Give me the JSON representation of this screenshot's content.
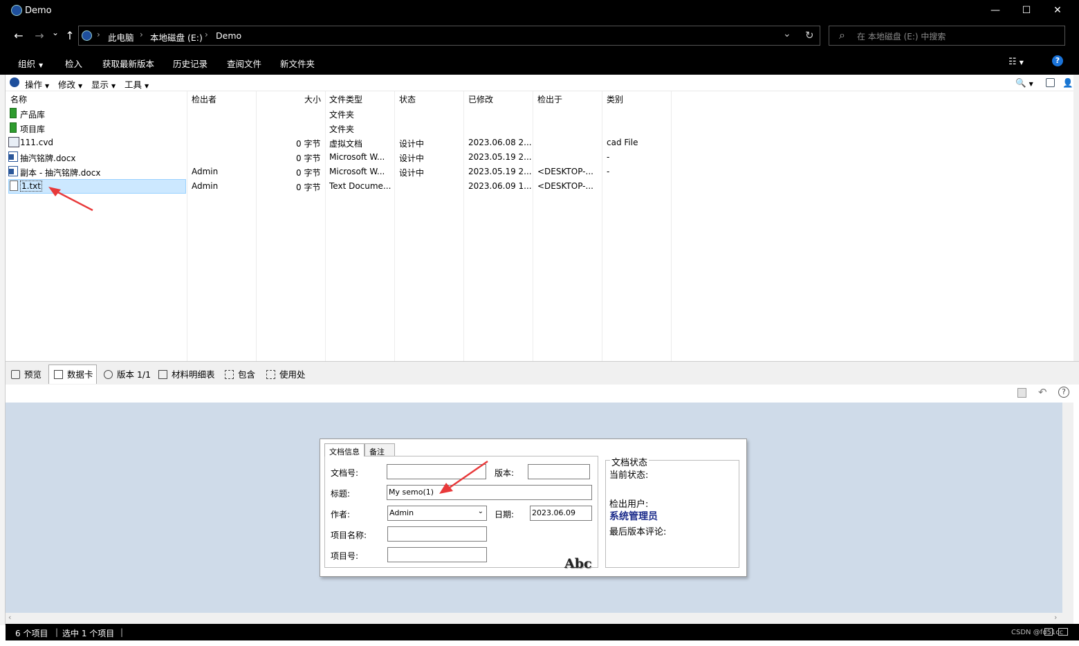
{
  "window": {
    "title": "Demo",
    "min": "—",
    "max": "☐",
    "close": "✕"
  },
  "nav": {
    "back": "←",
    "forward": "→",
    "down": "⌄",
    "up": "↑"
  },
  "address": {
    "crumbs": [
      "此电脑",
      "本地磁盘 (E:)",
      "Demo"
    ],
    "refresh": "↻",
    "dropdown": "⌄"
  },
  "search": {
    "placeholder": "在 本地磁盘 (E:) 中搜索",
    "icon": "⌕"
  },
  "commands": [
    "组织",
    "检入",
    "获取最新版本",
    "历史记录",
    "查阅文件",
    "新文件夹"
  ],
  "help_icon": "?",
  "toolbar": {
    "menus": [
      "操作",
      "修改",
      "显示",
      "工具"
    ]
  },
  "columns": [
    "名称",
    "检出者",
    "大小",
    "文件类型",
    "状态",
    "已修改",
    "检出于",
    "类别"
  ],
  "files": [
    {
      "name": "产品库",
      "checked_out_by": "",
      "size": "",
      "type": "文件夹",
      "state": "",
      "modified": "",
      "checked_out_in": "",
      "category": "",
      "icon": "folder-icon"
    },
    {
      "name": "项目库",
      "checked_out_by": "",
      "size": "",
      "type": "文件夹",
      "state": "",
      "modified": "",
      "checked_out_in": "",
      "category": "",
      "icon": "folder-icon"
    },
    {
      "name": "111.cvd",
      "checked_out_by": "",
      "size": "0 字节",
      "type": "虚拟文档",
      "state": "设计中",
      "modified": "2023.06.08 2...",
      "checked_out_in": "",
      "category": "cad File",
      "icon": "cvd-file-icon"
    },
    {
      "name": "抽汽铭牌.docx",
      "checked_out_by": "",
      "size": "0 字节",
      "type": "Microsoft W...",
      "state": "设计中",
      "modified": "2023.05.19 2...",
      "checked_out_in": "",
      "category": "-",
      "icon": "word-icon"
    },
    {
      "name": "副本 - 抽汽铭牌.docx",
      "checked_out_by": "Admin",
      "size": "0 字节",
      "type": "Microsoft W...",
      "state": "设计中",
      "modified": "2023.05.19 2...",
      "checked_out_in": "<DESKTOP-...",
      "category": "-",
      "icon": "word-icon"
    },
    {
      "name": "1.txt",
      "checked_out_by": "Admin",
      "size": "0 字节",
      "type": "Text Docume...",
      "state": "",
      "modified": "2023.06.09 1...",
      "checked_out_in": "<DESKTOP-...",
      "category": "",
      "icon": "text-file-icon"
    }
  ],
  "panel_tabs": [
    "预览",
    "数据卡",
    "版本 1/1",
    "材料明细表",
    "包含",
    "使用处"
  ],
  "card": {
    "tabs": [
      "文档信息",
      "备注"
    ],
    "labels": {
      "doc_no": "文档号:",
      "version": "版本:",
      "title": "标题:",
      "author": "作者:",
      "date": "日期:",
      "project_name": "项目名称:",
      "project_no": "项目号:"
    },
    "values": {
      "doc_no": "",
      "version": "",
      "title": "My semo(1)",
      "author": "Admin",
      "date": "2023.06.09",
      "project_name": "",
      "project_no": ""
    },
    "status": {
      "legend": "文档状态",
      "current_state": "当前状态:",
      "checkout_user": "检出用户:",
      "user_value": "系统管理员",
      "last_comment": "最后版本评论:"
    },
    "abc": "Abc"
  },
  "statusbar": {
    "items": "6 个项目",
    "selected": "选中 1 个项目",
    "watermark": "CSDN @fd51cc"
  },
  "colors": {
    "selection": "#cce8ff",
    "pane": "#cfdbe9",
    "annotation": "#e8393a",
    "user_value": "#1a2a8a"
  }
}
